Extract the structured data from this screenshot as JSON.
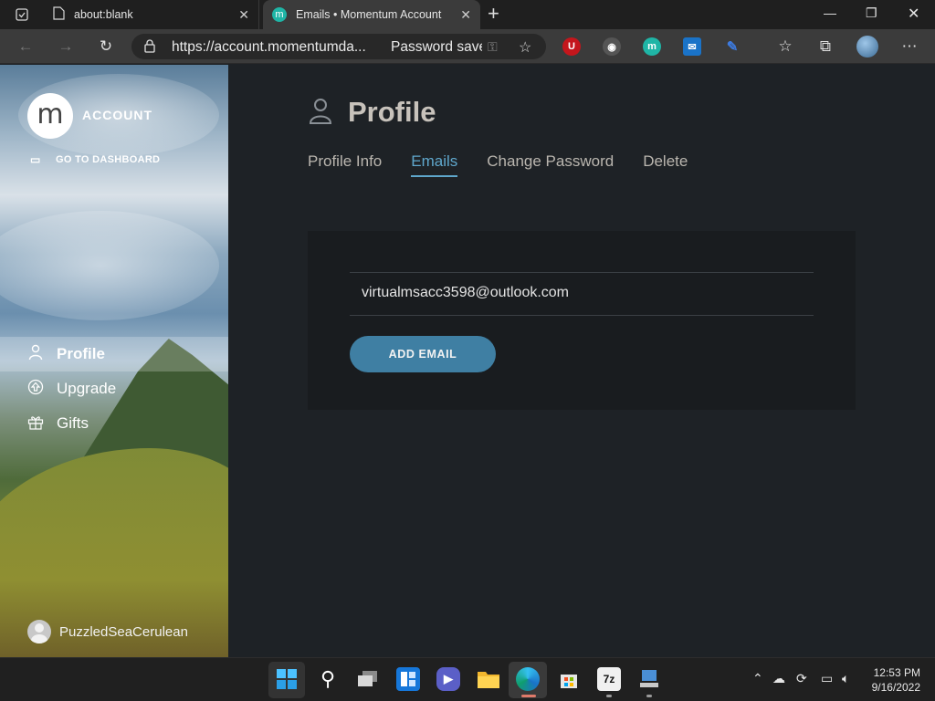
{
  "browser": {
    "tabs": [
      {
        "title": "about:blank"
      },
      {
        "title": "Emails • Momentum Account",
        "favicon": "m"
      }
    ],
    "address": {
      "url": "https://account.momentumda...",
      "status": "Password save"
    },
    "extensions": [
      "U",
      "m"
    ]
  },
  "sidebar": {
    "logo_letter": "m",
    "account_label": "ACCOUNT",
    "dashboard_link": "GO TO DASHBOARD",
    "nav": [
      {
        "label": "Profile",
        "icon": "user-icon"
      },
      {
        "label": "Upgrade",
        "icon": "upgrade-icon"
      },
      {
        "label": "Gifts",
        "icon": "gift-icon"
      }
    ],
    "user": "PuzzledSeaCerulean"
  },
  "main": {
    "title": "Profile",
    "tabs": [
      {
        "label": "Profile Info"
      },
      {
        "label": "Emails"
      },
      {
        "label": "Change Password"
      },
      {
        "label": "Delete"
      }
    ],
    "active_tab": "Emails",
    "email_value": "virtualmsacc3598@outlook.com",
    "add_email_label": "ADD EMAIL"
  },
  "taskbar": {
    "apps": [
      "7z"
    ],
    "time": "12:53 PM",
    "date": "9/16/2022"
  },
  "colors": {
    "accent": "#5fa7cc",
    "button": "#3f7fa3",
    "background": "#1e2226"
  }
}
